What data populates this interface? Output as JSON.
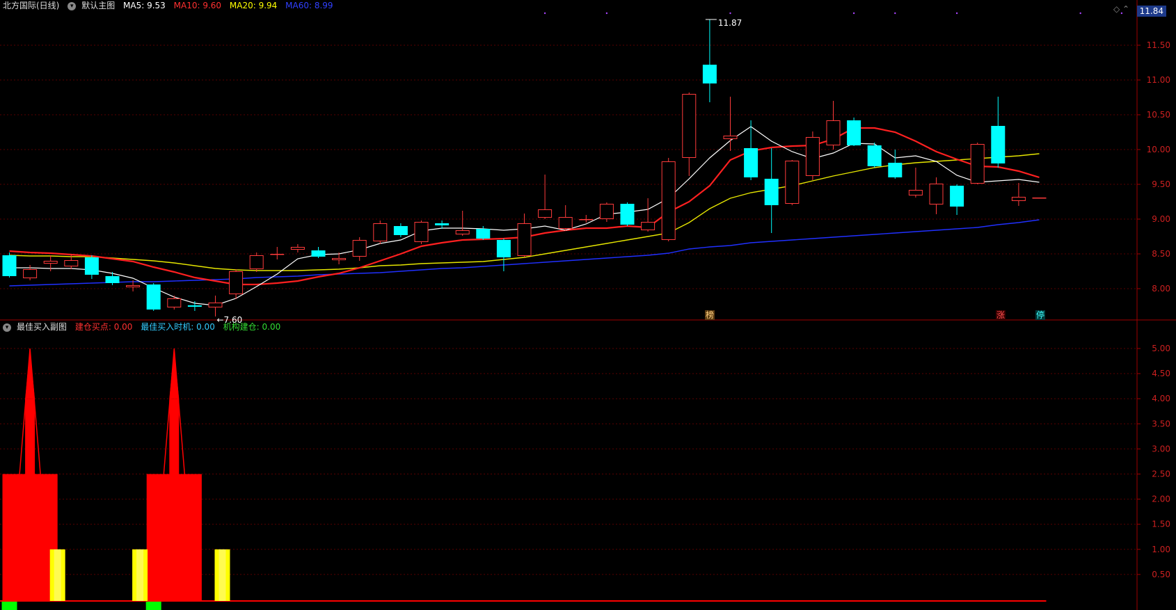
{
  "header": {
    "stock": "北方国际(日线)",
    "main_chart_label": "默认主图",
    "ma5": "MA5: 9.53",
    "ma10": "MA10: 9.60",
    "ma20": "MA20: 9.94",
    "ma60": "MA60: 8.99",
    "last_price": "11.84"
  },
  "sub_header": {
    "title": "最佳买入副图",
    "build_point": "建仓买点: 0.00",
    "best_time": "最佳买入时机: 0.00",
    "inst_build": "机构建仓: 0.00"
  },
  "tags": {
    "bang": "榜",
    "zhang": "涨",
    "ting": "停"
  },
  "colors": {
    "up": "#ff3b3b",
    "down": "#00ffff",
    "ma5": "#ffffff",
    "ma10": "#ff2020",
    "ma20": "#e6e600",
    "ma60": "#2030ff",
    "grid": "#7a0000",
    "build_point": "#ff0000",
    "best_time": "#ffff00",
    "inst_build": "#00ff00"
  },
  "chart_data": [
    {
      "type": "candlestick",
      "ylim": [
        7.55,
        11.95
      ],
      "yticks": [
        "11.50",
        "11.00",
        "10.50",
        "10.00",
        "9.50",
        "9.00",
        "8.50",
        "8.00"
      ],
      "annotations": [
        {
          "text": "11.87",
          "candle": 34,
          "value": 11.87
        },
        {
          "text": "7.60",
          "candle": 10,
          "value": 7.6
        }
      ],
      "candles": [
        [
          8.48,
          8.18,
          8.52,
          8.16
        ],
        [
          8.15,
          8.28,
          8.34,
          8.12
        ],
        [
          8.36,
          8.4,
          8.48,
          8.25
        ],
        [
          8.32,
          8.41,
          8.5,
          8.28
        ],
        [
          8.45,
          8.2,
          8.48,
          8.14
        ],
        [
          8.18,
          8.08,
          8.24,
          8.05
        ],
        [
          8.02,
          8.05,
          8.12,
          7.96
        ],
        [
          8.06,
          7.7,
          8.08,
          7.68
        ],
        [
          7.73,
          7.86,
          7.9,
          7.7
        ],
        [
          7.76,
          7.74,
          7.82,
          7.68
        ],
        [
          7.73,
          7.8,
          7.9,
          7.6
        ],
        [
          7.92,
          8.25,
          8.28,
          7.85
        ],
        [
          8.28,
          8.48,
          8.52,
          8.24
        ],
        [
          8.49,
          8.5,
          8.6,
          8.42
        ],
        [
          8.56,
          8.6,
          8.64,
          8.52
        ],
        [
          8.55,
          8.46,
          8.6,
          8.44
        ],
        [
          8.41,
          8.44,
          8.52,
          8.35
        ],
        [
          8.46,
          8.7,
          8.74,
          8.4
        ],
        [
          8.68,
          8.94,
          8.98,
          8.64
        ],
        [
          8.9,
          8.77,
          8.94,
          8.74
        ],
        [
          8.67,
          8.96,
          8.98,
          8.64
        ],
        [
          8.94,
          8.91,
          8.98,
          8.86
        ],
        [
          8.78,
          8.84,
          9.12,
          8.76
        ],
        [
          8.86,
          8.72,
          8.9,
          8.7
        ],
        [
          8.7,
          8.45,
          8.72,
          8.25
        ],
        [
          8.47,
          8.94,
          9.08,
          8.45
        ],
        [
          9.02,
          9.14,
          9.64,
          9.0
        ],
        [
          8.86,
          9.03,
          9.2,
          8.83
        ],
        [
          9.0,
          9.0,
          9.06,
          8.95
        ],
        [
          9.0,
          9.22,
          9.24,
          8.96
        ],
        [
          9.22,
          8.92,
          9.24,
          8.9
        ],
        [
          8.84,
          8.96,
          9.3,
          8.82
        ],
        [
          8.7,
          9.83,
          9.88,
          8.68
        ],
        [
          9.88,
          10.8,
          10.82,
          9.62
        ],
        [
          11.22,
          10.95,
          11.87,
          10.68
        ],
        [
          10.15,
          10.2,
          10.76,
          9.98
        ],
        [
          10.02,
          9.6,
          10.42,
          9.56
        ],
        [
          9.58,
          9.2,
          10.02,
          8.8
        ],
        [
          9.22,
          9.84,
          9.85,
          9.2
        ],
        [
          9.62,
          10.18,
          10.26,
          9.56
        ],
        [
          10.06,
          10.42,
          10.7,
          10.0
        ],
        [
          10.42,
          10.06,
          10.46,
          10.05
        ],
        [
          10.06,
          9.76,
          10.1,
          9.74
        ],
        [
          9.81,
          9.6,
          10.0,
          9.58
        ],
        [
          9.34,
          9.42,
          9.74,
          9.31
        ],
        [
          9.21,
          9.51,
          9.6,
          9.07
        ],
        [
          9.48,
          9.18,
          9.5,
          9.06
        ],
        [
          9.51,
          10.08,
          10.1,
          9.5
        ],
        [
          10.34,
          9.8,
          10.76,
          9.74
        ],
        [
          9.26,
          9.32,
          9.52,
          9.19
        ],
        [
          9.31,
          9.31,
          9.31,
          9.31
        ]
      ],
      "ma5": [
        8.3,
        8.3,
        8.29,
        8.29,
        8.27,
        8.22,
        8.15,
        8.01,
        7.88,
        7.79,
        7.76,
        7.86,
        8.03,
        8.21,
        8.43,
        8.49,
        8.5,
        8.56,
        8.65,
        8.7,
        8.83,
        8.87,
        8.87,
        8.86,
        8.84,
        8.86,
        8.9,
        8.84,
        8.93,
        9.07,
        9.1,
        9.14,
        9.3,
        9.58,
        9.88,
        10.13,
        10.33,
        10.12,
        9.97,
        9.87,
        9.95,
        10.09,
        10.08,
        9.88,
        9.91,
        9.83,
        9.63,
        9.53,
        9.55,
        9.57,
        9.53
      ],
      "ma10": [
        8.54,
        8.52,
        8.51,
        8.49,
        8.47,
        8.43,
        8.39,
        8.31,
        8.24,
        8.16,
        8.11,
        8.06,
        8.06,
        8.08,
        8.11,
        8.17,
        8.22,
        8.3,
        8.4,
        8.5,
        8.61,
        8.66,
        8.7,
        8.71,
        8.72,
        8.74,
        8.8,
        8.84,
        8.87,
        8.87,
        8.9,
        8.88,
        9.1,
        9.25,
        9.48,
        9.85,
        9.98,
        10.03,
        10.05,
        10.06,
        10.15,
        10.31,
        10.31,
        10.25,
        10.12,
        9.97,
        9.86,
        9.76,
        9.75,
        9.69,
        9.6
      ],
      "ma20": [
        8.48,
        8.47,
        8.47,
        8.46,
        8.46,
        8.44,
        8.42,
        8.4,
        8.37,
        8.33,
        8.29,
        8.27,
        8.26,
        8.26,
        8.26,
        8.27,
        8.28,
        8.3,
        8.33,
        8.34,
        8.36,
        8.37,
        8.38,
        8.39,
        8.42,
        8.45,
        8.5,
        8.55,
        8.6,
        8.65,
        8.7,
        8.75,
        8.8,
        8.95,
        9.15,
        9.3,
        9.38,
        9.43,
        9.48,
        9.55,
        9.62,
        9.68,
        9.74,
        9.78,
        9.81,
        9.83,
        9.85,
        9.87,
        9.89,
        9.91,
        9.94
      ],
      "ma60": [
        8.04,
        8.05,
        8.06,
        8.07,
        8.08,
        8.09,
        8.1,
        8.1,
        8.11,
        8.12,
        8.13,
        8.14,
        8.16,
        8.17,
        8.18,
        8.2,
        8.21,
        8.22,
        8.23,
        8.25,
        8.27,
        8.29,
        8.3,
        8.32,
        8.34,
        8.36,
        8.38,
        8.4,
        8.42,
        8.44,
        8.46,
        8.48,
        8.51,
        8.57,
        8.6,
        8.62,
        8.66,
        8.68,
        8.7,
        8.72,
        8.74,
        8.76,
        8.78,
        8.8,
        8.82,
        8.84,
        8.86,
        8.88,
        8.92,
        8.95,
        8.99
      ]
    },
    {
      "type": "bar",
      "ylim": [
        0,
        5.25
      ],
      "yticks": [
        "5.00",
        "4.50",
        "4.00",
        "3.50",
        "3.00",
        "2.50",
        "2.00",
        "1.50",
        "1.00",
        "0.50"
      ],
      "build_point": [
        {
          "from": 0,
          "to": 2,
          "value": 2.5
        },
        {
          "from": 7,
          "to": 9,
          "value": 2.5
        }
      ],
      "build_peaks": [
        {
          "candle": 1,
          "value": 5.0
        },
        {
          "candle": 8,
          "value": 5.0
        }
      ],
      "best_time": [
        {
          "candle": 2,
          "value": 1.0
        },
        {
          "candle": 6,
          "value": 1.0
        },
        {
          "candle": 10,
          "value": 1.0
        }
      ],
      "inst_build": [
        {
          "candle": 0,
          "value": 0.2
        },
        {
          "candle": 7,
          "value": 0.2
        }
      ]
    }
  ]
}
